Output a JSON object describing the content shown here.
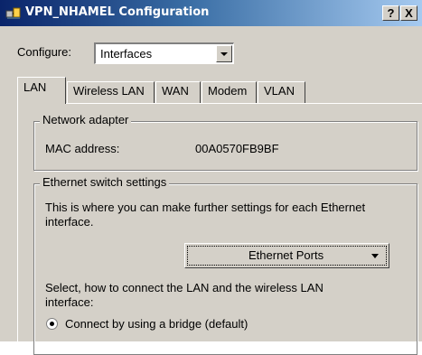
{
  "window": {
    "title": "VPN_NHAMEL Configuration",
    "help_label": "?",
    "close_label": "X"
  },
  "configure": {
    "label": "Configure:",
    "selected": "Interfaces"
  },
  "tabs": [
    {
      "label": "LAN",
      "active": true
    },
    {
      "label": "Wireless LAN",
      "active": false
    },
    {
      "label": "WAN",
      "active": false
    },
    {
      "label": "Modem",
      "active": false
    },
    {
      "label": "VLAN",
      "active": false
    }
  ],
  "network_adapter": {
    "title": "Network adapter",
    "mac_label": "MAC address:",
    "mac_value": "00A0570FB9BF"
  },
  "ethernet_switch": {
    "title": "Ethernet switch settings",
    "description_line1": "This is where you can make further settings for each Ethernet",
    "description_line2": "interface.",
    "ports_button": "Ethernet Ports",
    "connect_line1": "Select, how to connect the LAN and the wireless LAN",
    "connect_line2": "interface:",
    "option_bridge": "Connect by using a bridge (default)"
  },
  "colors": {
    "title_start": "#0a246a",
    "title_end": "#a6caf0",
    "face": "#d4d0c8"
  },
  "icons": {
    "app": "network-config-icon"
  }
}
